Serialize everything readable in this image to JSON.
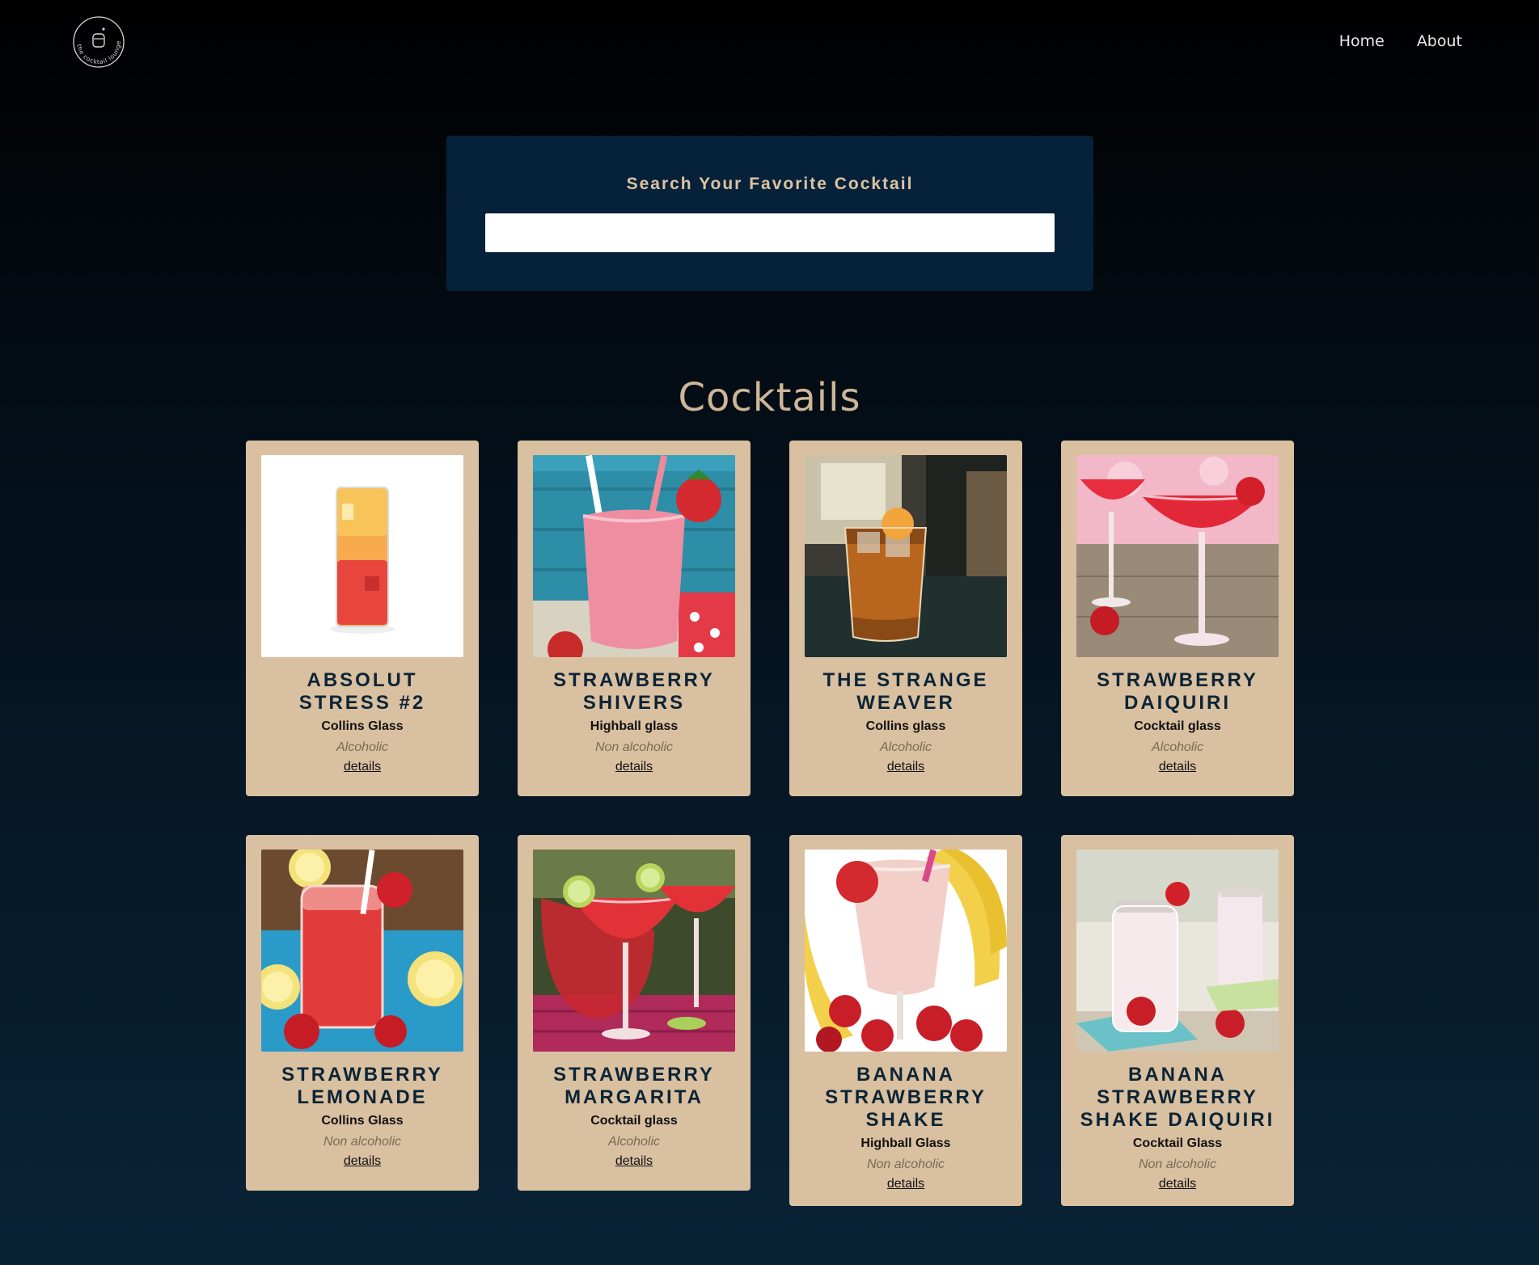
{
  "nav": {
    "logo_text": "the cocktail lounge",
    "links": [
      "Home",
      "About"
    ]
  },
  "search": {
    "label": "Search Your Favorite Cocktail",
    "value": "",
    "placeholder": ""
  },
  "section_title": "Cocktails",
  "cocktails": [
    {
      "name": "Absolut Stress #2",
      "glass": "Collins Glass",
      "type": "Alcoholic",
      "link": "details",
      "image": "orange-red-collins-drink"
    },
    {
      "name": "Strawberry Shivers",
      "glass": "Highball glass",
      "type": "Non alcoholic",
      "link": "details",
      "image": "pink-strawberry-smoothie"
    },
    {
      "name": "The Strange Weaver",
      "glass": "Collins glass",
      "type": "Alcoholic",
      "link": "details",
      "image": "amber-iced-drink"
    },
    {
      "name": "Strawberry Daiquiri",
      "glass": "Cocktail glass",
      "type": "Alcoholic",
      "link": "details",
      "image": "red-frozen-daiquiri"
    },
    {
      "name": "Strawberry Lemonade",
      "glass": "Collins Glass",
      "type": "Non alcoholic",
      "link": "details",
      "image": "strawberry-lemonade-jar"
    },
    {
      "name": "Strawberry Margarita",
      "glass": "Cocktail glass",
      "type": "Alcoholic",
      "link": "details",
      "image": "red-margarita-glasses"
    },
    {
      "name": "Banana Strawberry Shake",
      "glass": "Highball Glass",
      "type": "Non alcoholic",
      "link": "details",
      "image": "pink-banana-shake"
    },
    {
      "name": "Banana Strawberry Shake Daiquiri",
      "glass": "Cocktail Glass",
      "type": "Non alcoholic",
      "link": "details",
      "image": "pink-shake-jars"
    }
  ],
  "colors": {
    "card_bg": "#d9c0a0",
    "search_bg": "#06213a",
    "accent": "#cfb597"
  }
}
